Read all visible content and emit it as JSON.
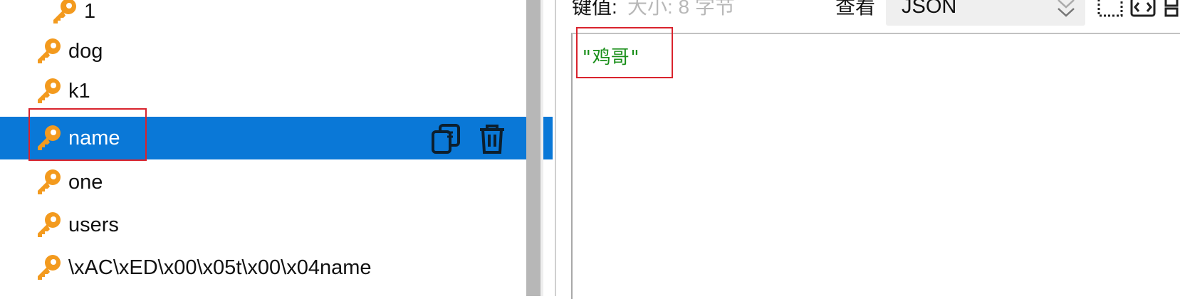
{
  "tree": {
    "items": [
      {
        "label": "1",
        "selected": false
      },
      {
        "label": "dog",
        "selected": false
      },
      {
        "label": "k1",
        "selected": false
      },
      {
        "label": "name",
        "selected": true
      },
      {
        "label": "one",
        "selected": false
      },
      {
        "label": "users",
        "selected": false
      },
      {
        "label": "\\xAC\\xED\\x00\\x05t\\x00\\x04name",
        "selected": false
      }
    ],
    "actions": {
      "copy_icon": "copy-icon",
      "delete_icon": "trash-icon"
    }
  },
  "value_panel": {
    "key_value_label": "键值:",
    "size_label": "大小: 8 字节",
    "view_label": "查看",
    "format_value": "JSON",
    "editor_text": "\"鸡哥\""
  },
  "colors": {
    "selection": "#0a78d7",
    "key_icon": "#f39a1e",
    "highlight_box": "#d9232d",
    "string_text": "#1a8f1a"
  }
}
